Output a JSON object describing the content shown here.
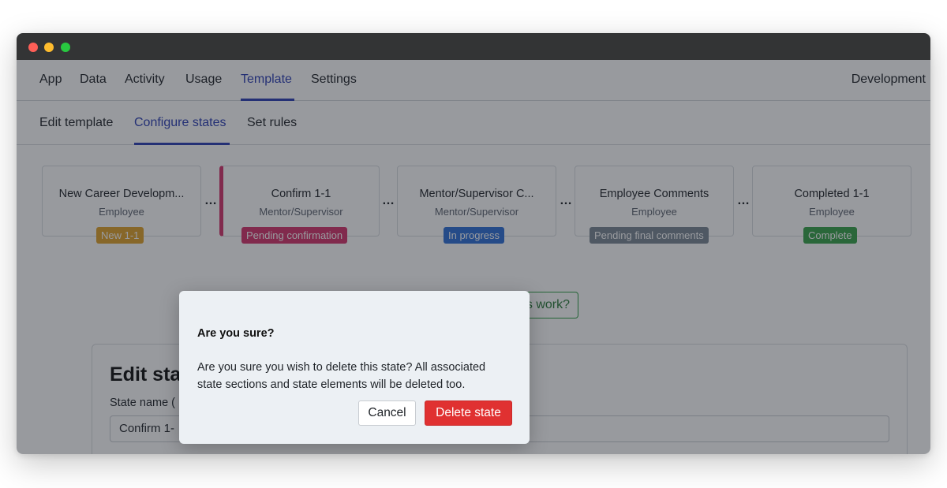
{
  "topnav": {
    "items": [
      "App",
      "Data",
      "Activity",
      "Usage",
      "Template",
      "Settings"
    ],
    "active": "Template",
    "environment": "Development"
  },
  "subnav": {
    "items": [
      "Edit template",
      "Configure states",
      "Set rules"
    ],
    "active": "Configure states"
  },
  "states": [
    {
      "title": "New Career Developm...",
      "role": "Employee",
      "badge": "New 1-1",
      "badge_color": "#e1a32a"
    },
    {
      "title": "Confirm 1-1",
      "role": "Mentor/Supervisor",
      "badge": "Pending confirmation",
      "badge_color": "#d6336c"
    },
    {
      "title": "Mentor/Supervisor C...",
      "role": "Mentor/Supervisor",
      "badge": "In progress",
      "badge_color": "#2f6fd8"
    },
    {
      "title": "Employee Comments",
      "role": "Employee",
      "badge": "Pending final comments",
      "badge_color": "#7b8794"
    },
    {
      "title": "Completed 1-1",
      "role": "Employee",
      "badge": "Complete",
      "badge_color": "#37a24a"
    }
  ],
  "separator": "…",
  "help_button": "s work?",
  "edit_panel": {
    "heading": "Edit sta",
    "state_name_label": "State name (",
    "state_name_value": "Confirm 1-"
  },
  "modal": {
    "title": "Are you sure?",
    "body": "Are you sure you wish to delete this state? All associated state sections and state elements will be deleted too.",
    "cancel_label": "Cancel",
    "delete_label": "Delete state",
    "delete_color": "#e03131"
  }
}
